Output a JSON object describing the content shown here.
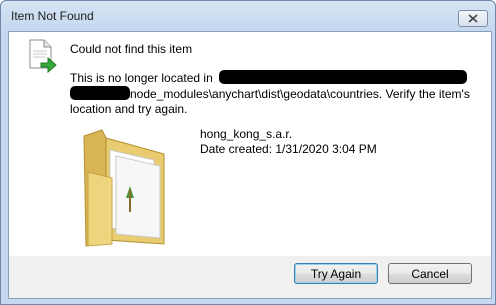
{
  "window": {
    "title": "Item Not Found"
  },
  "dialog": {
    "heading": "Could not find this item",
    "message_line1": "This is no longer located in",
    "message_line2": "node_modules\\anychart\\dist\\geodata\\countries. Verify the item's",
    "message_line3": "location and try again."
  },
  "item": {
    "name": "hong_kong_s.a.r.",
    "date_created": "Date created: 1/31/2020 3:04 PM"
  },
  "buttons": {
    "try_again": "Try Again",
    "cancel": "Cancel"
  },
  "icons": {
    "close": "close-icon",
    "document": "document-with-arrow-icon",
    "folder": "folder-icon"
  },
  "colors": {
    "titlebar": "#c5d8ef",
    "folder": "#e8c86a",
    "arrow": "#37a83a"
  }
}
